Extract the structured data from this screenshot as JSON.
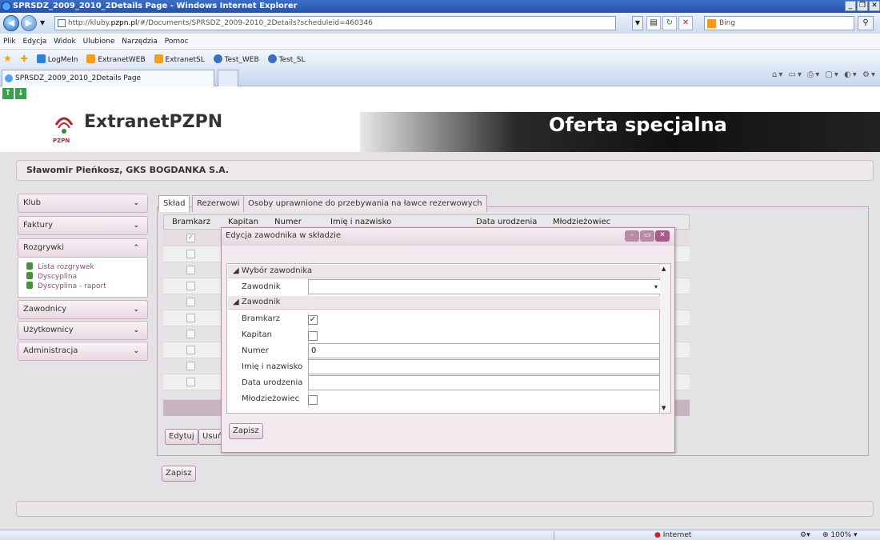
{
  "window": {
    "title": "SPRSDZ_2009_2010_2Details Page - Windows Internet Explorer"
  },
  "address": {
    "prefix": "http://kluby.",
    "domain": "pzpn.pl",
    "path": "/#/Documents/SPRSDZ_2009-2010_2Details?scheduleid=460346"
  },
  "search": {
    "placeholder": "Bing"
  },
  "menu": [
    "Plik",
    "Edycja",
    "Widok",
    "Ulubione",
    "Narzędzia",
    "Pomoc"
  ],
  "favorites": [
    {
      "label": "LogMeIn",
      "color": "#2f7fd6"
    },
    {
      "label": "ExtranetWEB",
      "color": "#f0a020"
    },
    {
      "label": "ExtranetSL",
      "color": "#f0a020"
    },
    {
      "label": "Test_WEB",
      "color": "#3a6fbf"
    },
    {
      "label": "Test_SL",
      "color": "#3a6fbf"
    }
  ],
  "browser_tab": {
    "label": "SPRSDZ_2009_2010_2Details Page"
  },
  "header": {
    "brand": "ExtranetPZPN",
    "logo_text": "PZPN",
    "promo": "Oferta specjalna"
  },
  "user": {
    "name": "Sławomir Pieńkosz, GKS BOGDANKA S.A."
  },
  "sidebar": {
    "items": [
      "Klub",
      "Faktury",
      "Rozgrywki",
      "Zawodnicy",
      "Użytkownicy",
      "Administracja"
    ],
    "sub": [
      "Lista rozgrywek",
      "Dyscyplina",
      "Dyscyplina - raport"
    ]
  },
  "tabs": [
    "Skład",
    "Rezerwowi",
    "Osoby uprawnione do przebywania na ławce rezerwowych"
  ],
  "grid": {
    "columns": [
      "Bramkarz",
      "Kapitan",
      "Numer",
      "Imię i nazwisko",
      "Data urodzenia",
      "Młodzieżowiec"
    ],
    "checked_first_row": true
  },
  "buttons": {
    "edit": "Edytuj",
    "remove": "Usuń",
    "save_main": "Zapisz",
    "save_modal": "Zapisz"
  },
  "modal": {
    "title": "Edycja zawodnika w składzie",
    "section1": "Wybór zawodnika",
    "section2": "Zawodnik",
    "fields": {
      "zawodnik_label": "Zawodnik",
      "bramkarz_label": "Bramkarz",
      "kapitan_label": "Kapitan",
      "numer_label": "Numer",
      "numer_value": "0",
      "imie_label": "Imię i nazwisko",
      "data_label": "Data urodzenia",
      "mlodziezowiec_label": "Młodzieżowiec"
    }
  },
  "status": {
    "zone": "Internet",
    "zoom": "100%"
  }
}
